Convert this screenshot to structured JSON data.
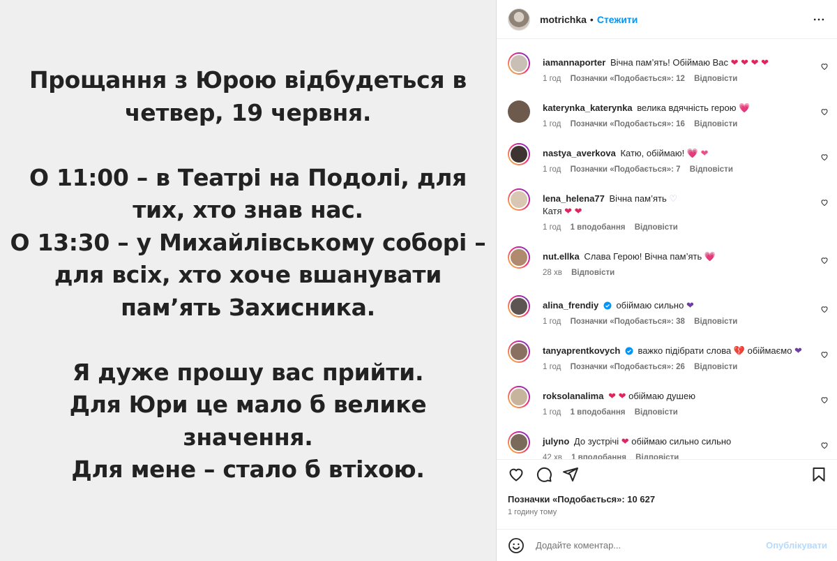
{
  "post_image": {
    "lines": [
      "Прощання з Юрою відбудеться в",
      "четвер, 19 червня.",
      "",
      "О 11:00 – в Театрі на Подолі, для",
      "тих, хто знав нас.",
      "О 13:30 – у Михайлівському соборі –",
      "для всіх, хто хоче вшанувати",
      "пам’ять Захисника.",
      "",
      "Я дуже прошу вас прийти.",
      "Для Юри це мало б велике",
      "значення.",
      "Для мене – стало б втіхою."
    ]
  },
  "header": {
    "username": "motrichka",
    "dot": "•",
    "follow_label": "Стежити"
  },
  "comments": [
    {
      "user": "iamannaporter",
      "text": "Вічна пам’ять! Обіймаю Вас",
      "emoji": "❤ ❤ ❤ ❤",
      "time": "1 год",
      "likes": "Позначки «Подобається»: 12",
      "reply": "Відповісти",
      "ring": true
    },
    {
      "user": "katerynka_katerynka",
      "text": "велика вдячність герою",
      "emoji": "💗",
      "time": "1 год",
      "likes": "Позначки «Подобається»: 16",
      "reply": "Відповісти",
      "ring": false
    },
    {
      "user": "nastya_averkova",
      "text": "Катю, обіймаю!",
      "emoji": "💗 ❤",
      "time": "1 год",
      "likes": "Позначки «Подобається»: 7",
      "reply": "Відповісти",
      "ring": true
    },
    {
      "user": "lena_helena77",
      "text": "Вічна пам’ять",
      "emoji": "♡",
      "text2": "Катя",
      "emoji2": "❤ ❤",
      "time": "1 год",
      "likes": "1 вподобання",
      "reply": "Відповісти",
      "ring": true
    },
    {
      "user": "nut.ellka",
      "text": "Слава Герою! Вічна пам’ять",
      "emoji": "💗",
      "time": "28 хв",
      "likes": "",
      "reply": "Відповісти",
      "ring": true
    },
    {
      "user": "alina_frendiy",
      "text": "обіймаю сильно",
      "emoji": "❤",
      "time": "1 год",
      "likes": "Позначки «Подобається»: 38",
      "reply": "Відповісти",
      "ring": true,
      "verified": true
    },
    {
      "user": "tanyaprentkovych",
      "text": "важко підібрати слова",
      "emoji": "💔",
      "text_b": "обіймаємо",
      "emoji_b": "❤",
      "time": "1 год",
      "likes": "Позначки «Подобається»: 26",
      "reply": "Відповісти",
      "ring": true,
      "verified": true
    },
    {
      "user": "roksolanalima",
      "text": "обіймаю душею",
      "emoji": "❤ ❤",
      "time": "1 год",
      "likes": "1 вподобання",
      "reply": "Відповісти",
      "ring": true
    },
    {
      "user": "julyno",
      "text": "До зустрічі",
      "emoji": "❤",
      "text_b": "обіймаю сильно сильно",
      "time": "42 хв",
      "likes": "1 вподобання",
      "reply": "Відповісти",
      "ring": true
    }
  ],
  "footer": {
    "likes_count": "Позначки «Подобається»: 10 627",
    "post_time": "1 годину тому",
    "comment_placeholder": "Додайте коментар...",
    "publish_label": "Опублікувати"
  },
  "colors": {
    "accent": "#0095f6",
    "muted": "#737373",
    "heart": "#e0245e",
    "purple_heart": "#6b3fa0"
  },
  "icons": [
    "more-icon",
    "like-icon",
    "comment-icon",
    "share-icon",
    "bookmark-icon",
    "emoji-icon",
    "verified-icon",
    "small-heart-icon"
  ]
}
